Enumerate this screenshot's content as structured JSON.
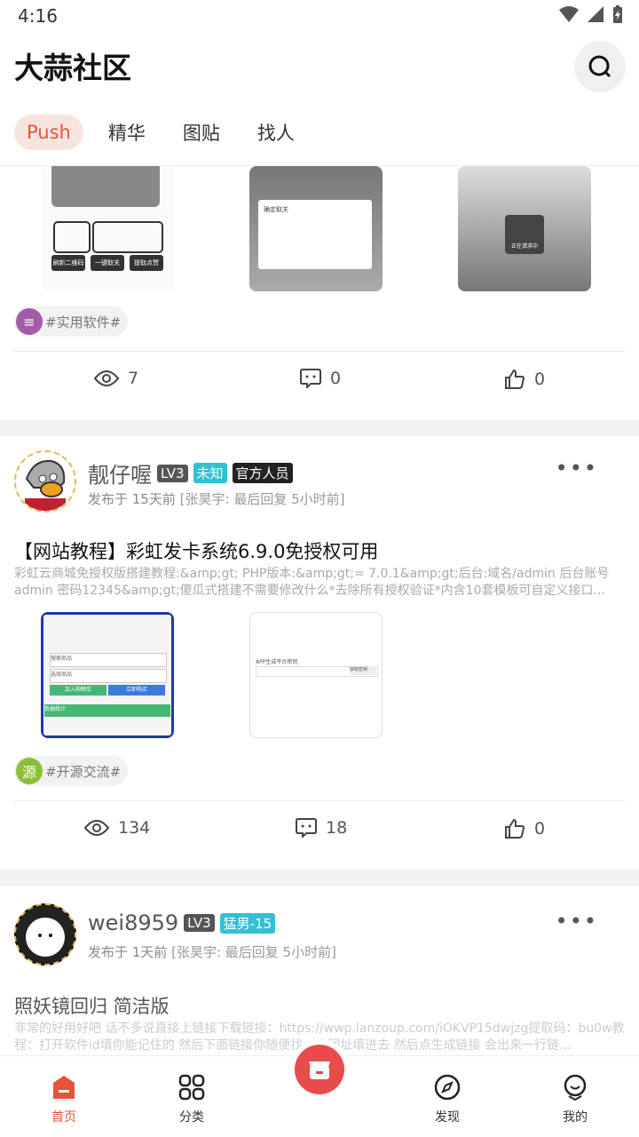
{
  "status": {
    "time": "4:16"
  },
  "header": {
    "title": "大蒜社区",
    "tabs": [
      "Push",
      "精华",
      "图贴",
      "找人"
    ]
  },
  "posts": [
    {
      "tag": "#实用软件#",
      "stats": {
        "views": "7",
        "comments": "0",
        "likes": "0"
      },
      "thumb_texts": [
        "确定取关",
        "正在请求中",
        "刷新二维码",
        "一键取关",
        "提取点赞"
      ]
    },
    {
      "user": "靓仔喔",
      "level": "LV3",
      "badges": [
        "未知",
        "官方人员"
      ],
      "time": "发布于 15天前",
      "reply": "[张昊宇: 最后回复 5小时前]",
      "title": "【网站教程】彩虹发卡系统6.9.0免授权可用",
      "summary": "彩虹云商城免授权版搭建教程:&amp;gt; PHP版本:&amp;gt;= 7.0.1&amp;gt;后台:域名/admin  后台账号admin 密码12345&amp;gt;傻瓜式搭建不需要修改什么*去除所有授权验证*内含10套模板可自定义接口...",
      "tag": "#开源交流#",
      "stats": {
        "views": "134",
        "comments": "18",
        "likes": "0"
      },
      "thumb_texts": [
        "搜索商品",
        "选择商品",
        "加入购物车",
        "立即购买",
        "数据统计",
        "APP生成平台密钥",
        "获取密钥"
      ]
    },
    {
      "user": "wei8959",
      "level": "LV3",
      "badges": [
        "猛男-15"
      ],
      "time": "发布于 1天前",
      "reply": "[张昊宇: 最后回复 5小时前]",
      "title": "照妖镜回归 简洁版",
      "summary": "非常的好用好吧 话不多说直接上链接下载链接：https://wwp.lanzoup.com/iOKVP15dwjzg提取码：bu0w教程：打开软件id填你能记住的 然后下面链接你随便找一个网址填进去 然后点生成链接 会出来一行链..."
    }
  ],
  "nav": {
    "items": [
      "首页",
      "分类",
      "发现",
      "我的"
    ]
  },
  "colors": {
    "accent": "#e8533a",
    "lv_badge": "#555555",
    "unknown_badge": "#33bfd6",
    "official_badge": "#222222"
  }
}
